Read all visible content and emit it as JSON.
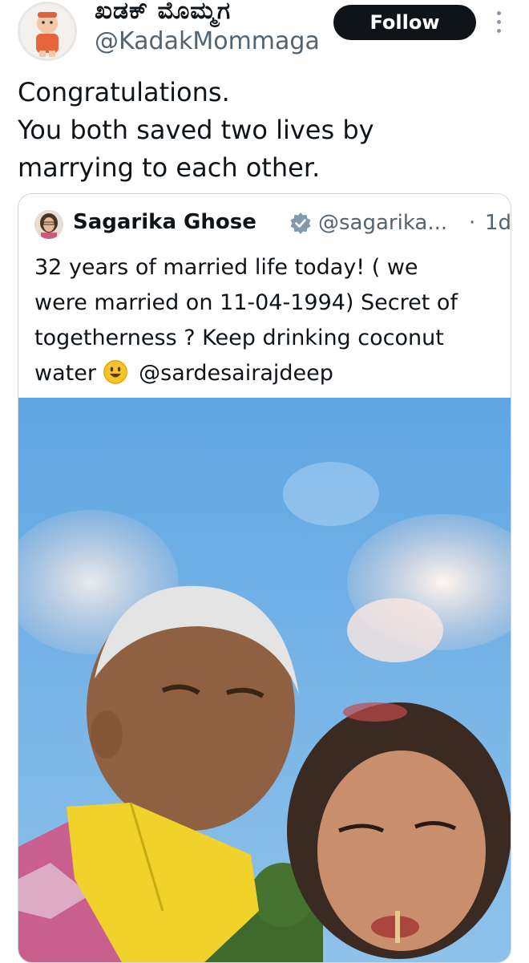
{
  "post": {
    "author_name": "ಖಡಕ್ ಮೊಮ್ಮಗ",
    "author_handle": "@KadakMommaga",
    "follow_label": "Follow",
    "text_lines": [
      "Congratulations.",
      "You both saved two lives by",
      "marrying to each other."
    ]
  },
  "quote": {
    "author_name": "Sagarika Ghose",
    "verified": true,
    "author_handle": "@sagarika...",
    "separator": "·",
    "time": "1d",
    "text_lines": [
      "32 years of married life today! ( we",
      "were married on 11-04-1994) Secret of",
      "togetherness ? Keep drinking coconut"
    ],
    "last_line_prefix": "water",
    "last_line_mention": "@sardesairajdeep",
    "emoji": "smiling-face-icon"
  },
  "colors": {
    "text": "#0f1419",
    "secondary": "#536471",
    "follow_bg": "#0f1419",
    "verified_badge": "#829aab",
    "border": "#cfd9de"
  }
}
